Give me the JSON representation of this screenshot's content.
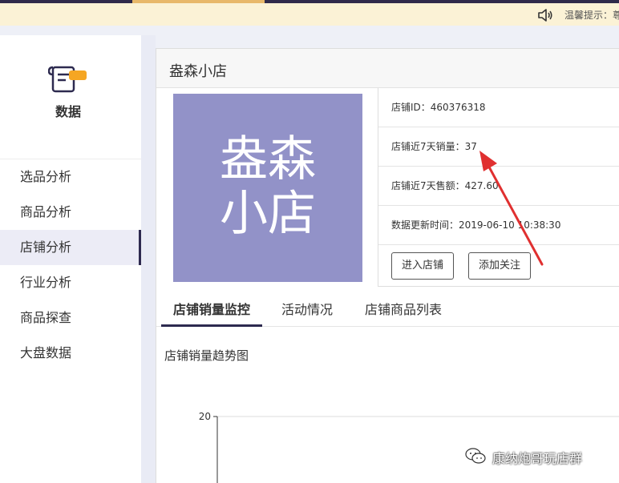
{
  "notice": {
    "text": "温馨提示：尊",
    "icon": "speaker-icon"
  },
  "sidebar": {
    "section_label": "数据",
    "section_icon": "scroll-icon",
    "items": [
      {
        "label": "选品分析"
      },
      {
        "label": "商品分析"
      },
      {
        "label": "店铺分析",
        "active": true
      },
      {
        "label": "行业分析"
      },
      {
        "label": "商品探查"
      },
      {
        "label": "大盘数据"
      }
    ]
  },
  "shop": {
    "name": "盎森小店",
    "logo_line1": "盎森",
    "logo_line2": "小店",
    "logo_color": "#9292c8",
    "info": {
      "shop_id": "店铺ID：460376318",
      "sales_7d": "店铺近7天销量：37",
      "revenue_7d": "店铺近7天售额：427.60",
      "updated": "数据更新时间：2019-06-10 10:38:30"
    },
    "enter_button": "进入店铺",
    "follow_button": "添加关注"
  },
  "tabs": [
    {
      "label": "店铺销量监控",
      "active": true
    },
    {
      "label": "活动情况"
    },
    {
      "label": "店铺商品列表"
    }
  ],
  "chart_data": {
    "type": "line",
    "title": "店铺销量趋势图",
    "y_ticks": [
      "20"
    ],
    "series": []
  },
  "watermark": {
    "text": "康纳炮哥玩店群"
  },
  "colors": {
    "accent": "#2d2a4f",
    "annotation": "#e03030",
    "notice_bg": "#fbf2d6"
  }
}
